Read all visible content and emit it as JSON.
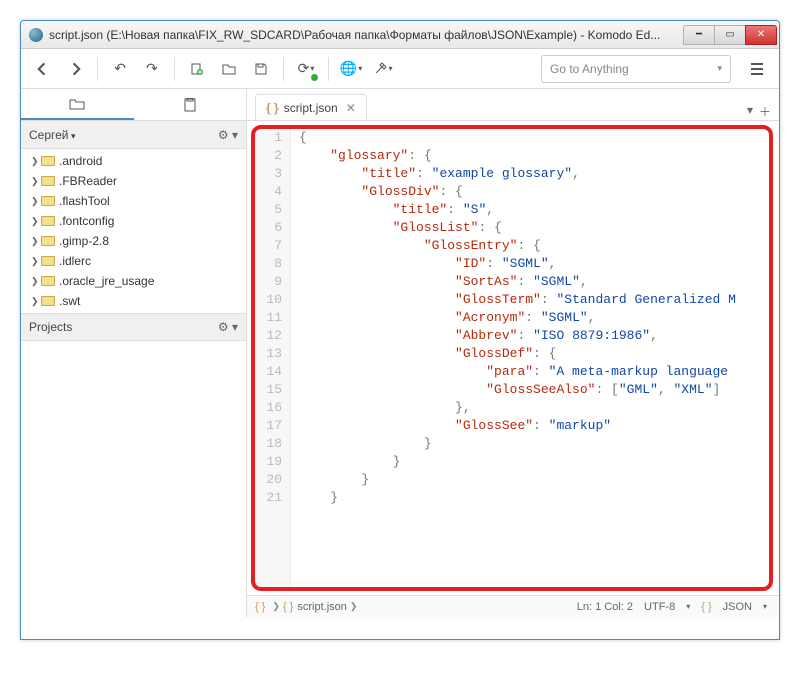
{
  "window": {
    "title": "script.json (E:\\Новая папка\\FIX_RW_SDCARD\\Рабочая папка\\Форматы файлов\\JSON\\Example) - Komodo Ed..."
  },
  "toolbar": {
    "goto_placeholder": "Go to Anything"
  },
  "sidebar": {
    "user": "Сергей",
    "projects_label": "Projects",
    "items": [
      {
        "label": ".android"
      },
      {
        "label": ".FBReader"
      },
      {
        "label": ".flashTool"
      },
      {
        "label": ".fontconfig"
      },
      {
        "label": ".gimp-2.8"
      },
      {
        "label": ".idlerc"
      },
      {
        "label": ".oracle_jre_usage"
      },
      {
        "label": ".swt"
      }
    ]
  },
  "tab": {
    "filename": "script.json"
  },
  "code": {
    "lines": [
      [
        [
          "punc",
          "{"
        ]
      ],
      [
        [
          "ws",
          "    "
        ],
        [
          "key",
          "\"glossary\""
        ],
        [
          "punc",
          ": {"
        ]
      ],
      [
        [
          "ws",
          "        "
        ],
        [
          "key",
          "\"title\""
        ],
        [
          "punc",
          ": "
        ],
        [
          "str",
          "\"example glossary\""
        ],
        [
          "punc",
          ","
        ]
      ],
      [
        [
          "ws",
          "        "
        ],
        [
          "key",
          "\"GlossDiv\""
        ],
        [
          "punc",
          ": {"
        ]
      ],
      [
        [
          "ws",
          "            "
        ],
        [
          "key",
          "\"title\""
        ],
        [
          "punc",
          ": "
        ],
        [
          "str",
          "\"S\""
        ],
        [
          "punc",
          ","
        ]
      ],
      [
        [
          "ws",
          "            "
        ],
        [
          "key",
          "\"GlossList\""
        ],
        [
          "punc",
          ": {"
        ]
      ],
      [
        [
          "ws",
          "                "
        ],
        [
          "key",
          "\"GlossEntry\""
        ],
        [
          "punc",
          ": {"
        ]
      ],
      [
        [
          "ws",
          "                    "
        ],
        [
          "key",
          "\"ID\""
        ],
        [
          "punc",
          ": "
        ],
        [
          "str",
          "\"SGML\""
        ],
        [
          "punc",
          ","
        ]
      ],
      [
        [
          "ws",
          "                    "
        ],
        [
          "key",
          "\"SortAs\""
        ],
        [
          "punc",
          ": "
        ],
        [
          "str",
          "\"SGML\""
        ],
        [
          "punc",
          ","
        ]
      ],
      [
        [
          "ws",
          "                    "
        ],
        [
          "key",
          "\"GlossTerm\""
        ],
        [
          "punc",
          ": "
        ],
        [
          "str",
          "\"Standard Generalized M"
        ]
      ],
      [
        [
          "ws",
          "                    "
        ],
        [
          "key",
          "\"Acronym\""
        ],
        [
          "punc",
          ": "
        ],
        [
          "str",
          "\"SGML\""
        ],
        [
          "punc",
          ","
        ]
      ],
      [
        [
          "ws",
          "                    "
        ],
        [
          "key",
          "\"Abbrev\""
        ],
        [
          "punc",
          ": "
        ],
        [
          "str",
          "\"ISO 8879:1986\""
        ],
        [
          "punc",
          ","
        ]
      ],
      [
        [
          "ws",
          "                    "
        ],
        [
          "key",
          "\"GlossDef\""
        ],
        [
          "punc",
          ": {"
        ]
      ],
      [
        [
          "ws",
          "                        "
        ],
        [
          "key",
          "\"para\""
        ],
        [
          "punc",
          ": "
        ],
        [
          "str",
          "\"A meta-markup language "
        ]
      ],
      [
        [
          "ws",
          "                        "
        ],
        [
          "key",
          "\"GlossSeeAlso\""
        ],
        [
          "punc",
          ": ["
        ],
        [
          "str",
          "\"GML\""
        ],
        [
          "punc",
          ", "
        ],
        [
          "str",
          "\"XML\""
        ],
        [
          "punc",
          "]"
        ]
      ],
      [
        [
          "ws",
          "                    "
        ],
        [
          "punc",
          "},"
        ]
      ],
      [
        [
          "ws",
          "                    "
        ],
        [
          "key",
          "\"GlossSee\""
        ],
        [
          "punc",
          ": "
        ],
        [
          "str",
          "\"markup\""
        ]
      ],
      [
        [
          "ws",
          "                "
        ],
        [
          "punc",
          "}"
        ]
      ],
      [
        [
          "ws",
          "            "
        ],
        [
          "punc",
          "}"
        ]
      ],
      [
        [
          "ws",
          "        "
        ],
        [
          "punc",
          "}"
        ]
      ],
      [
        [
          "ws",
          "    "
        ],
        [
          "punc",
          "}"
        ]
      ]
    ]
  },
  "breadcrumb": {
    "file": "script.json"
  },
  "status": {
    "pos": "Ln: 1 Col: 2",
    "encoding": "UTF-8",
    "lang": "JSON"
  }
}
